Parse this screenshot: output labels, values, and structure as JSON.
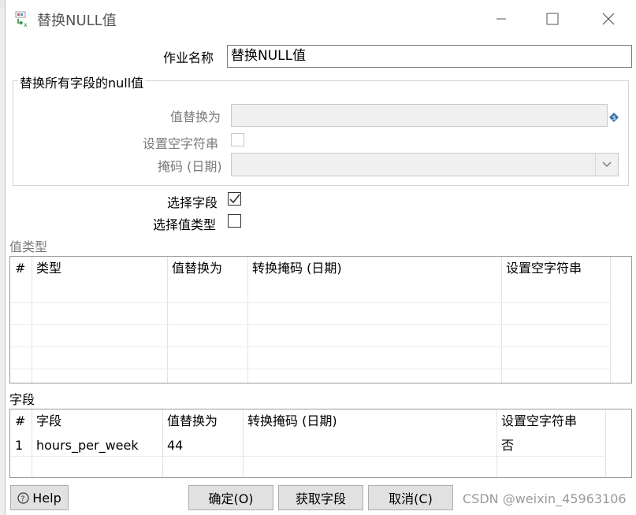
{
  "window": {
    "title": "替换NULL值"
  },
  "form": {
    "job_name_label": "作业名称",
    "job_name_value": "替换NULL值",
    "group_title": "替换所有字段的null值",
    "replace_value_label": "值替换为",
    "replace_value_value": "",
    "set_empty_string_label": "设置空字符串",
    "mask_date_label": "掩码 (日期)",
    "mask_date_value": "",
    "select_field_label": "选择字段",
    "select_field_checked": true,
    "select_value_type_label": "选择值类型",
    "select_value_type_checked": false
  },
  "value_type_table": {
    "label": "值类型",
    "columns": [
      "#",
      "类型",
      "值替换为",
      "转换掩码 (日期)",
      "设置空字符串"
    ],
    "rows": []
  },
  "fields_table": {
    "label": "字段",
    "columns": [
      "#",
      "字段",
      "值替换为",
      "转换掩码 (日期)",
      "设置空字符串"
    ],
    "rows": [
      {
        "index": "1",
        "field": "hours_per_week",
        "replace": "44",
        "mask": "",
        "empty": "否"
      }
    ]
  },
  "buttons": {
    "help": "Help",
    "ok": "确定(O)",
    "get_fields": "获取字段",
    "cancel": "取消(C)"
  },
  "watermark": "CSDN @weixin_45963106",
  "colors": {
    "accent_green": "#2e8b3d",
    "checkmark": "#333333",
    "disabled_bg": "#f0f0f0"
  }
}
